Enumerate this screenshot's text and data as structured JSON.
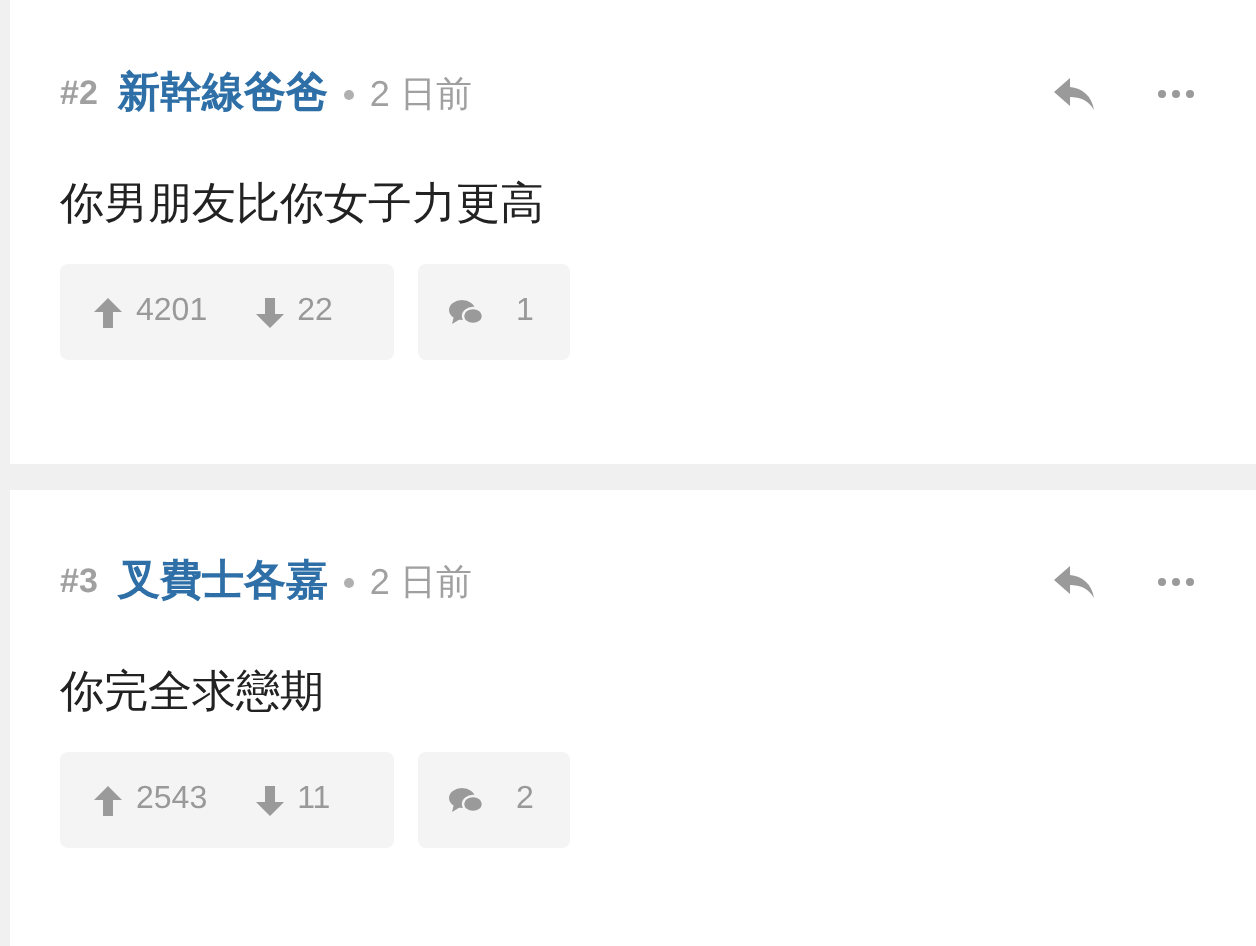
{
  "comments": [
    {
      "number": "#2",
      "author": "新幹線爸爸",
      "time": "2 日前",
      "text": "你男朋友比你女子力更高",
      "upvotes": "4201",
      "downvotes": "22",
      "replies": "1"
    },
    {
      "number": "#3",
      "author": "叉費士各嘉",
      "time": "2 日前",
      "text": "你完全求戀期",
      "upvotes": "2543",
      "downvotes": "11",
      "replies": "2"
    }
  ]
}
